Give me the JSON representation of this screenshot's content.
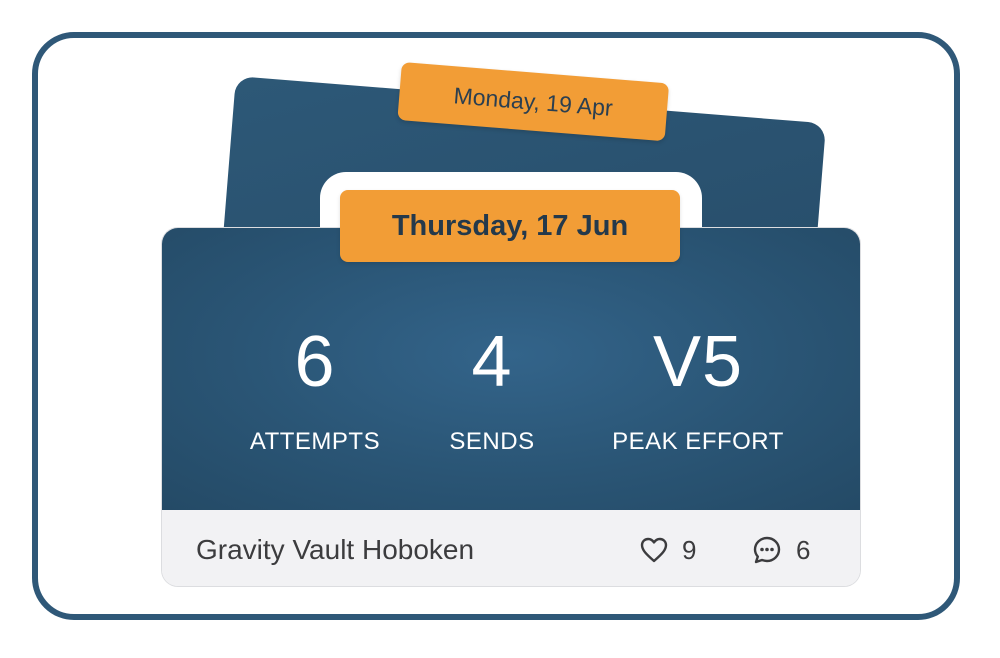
{
  "back_card": {
    "date": "Monday, 19 Apr"
  },
  "front_card": {
    "date": "Thursday, 17 Jun",
    "stats": [
      {
        "value": "6",
        "label": "ATTEMPTS"
      },
      {
        "value": "4",
        "label": "SENDS"
      },
      {
        "value": "V5",
        "label": "PEAK EFFORT"
      }
    ],
    "footer": {
      "gym": "Gravity Vault Hoboken",
      "likes": "9",
      "comments": "6",
      "like_icon": "heart-icon",
      "comment_icon": "comment-bubble-icon"
    }
  },
  "colors": {
    "card_blue": "#2a5575",
    "tag_orange": "#f29d36",
    "frame_border": "#2f5878",
    "footer_bg": "#f2f2f4"
  }
}
